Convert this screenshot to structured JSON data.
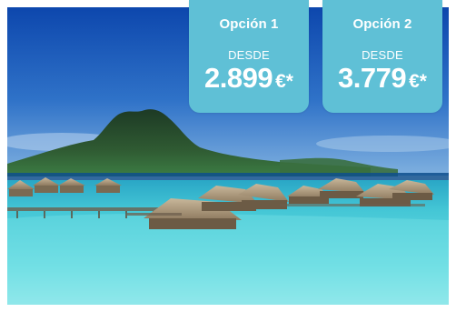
{
  "offers": [
    {
      "title": "Opción 1",
      "from_label": "DESDE",
      "price": "2.899",
      "currency": "€*"
    },
    {
      "title": "Opción 2",
      "from_label": "DESDE",
      "price": "3.779",
      "currency": "€*"
    }
  ],
  "colors": {
    "card_background": "#5fc0d6",
    "card_text": "#ffffff",
    "sky_top": "#0f4fb5",
    "lagoon": "#54d7e0"
  }
}
